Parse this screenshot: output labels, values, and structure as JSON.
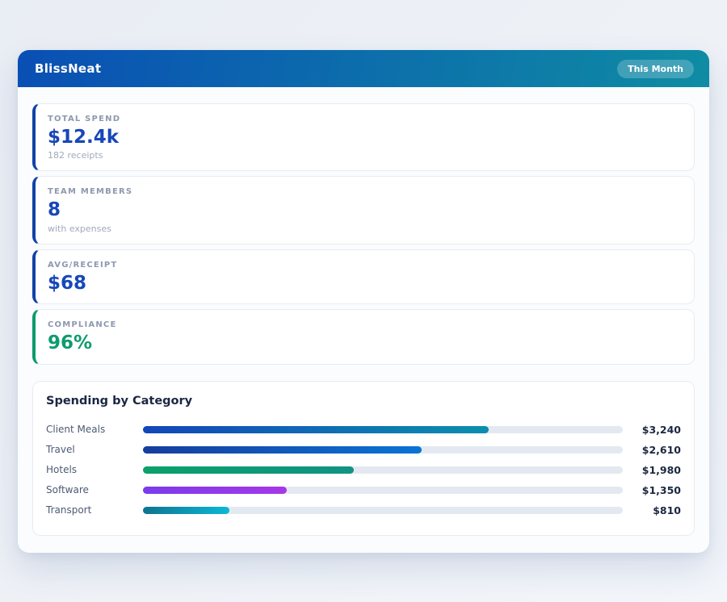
{
  "header": {
    "app_name": "BlissNeat",
    "period_badge": "This Month",
    "gradient_start": "#0a4fb4",
    "gradient_end": "#0f8ca3"
  },
  "stats": [
    {
      "label": "TOTAL SPEND",
      "value": "$12.4k",
      "sub": "182 receipts",
      "accent_color": "#1243a6",
      "value_color": "#1747b8"
    },
    {
      "label": "TEAM MEMBERS",
      "value": "8",
      "sub": "with expenses",
      "accent_color": "#1243a6",
      "value_color": "#1747b8"
    },
    {
      "label": "AVG/RECEIPT",
      "value": "$68",
      "sub": "",
      "accent_color": "#1243a6",
      "value_color": "#1747b8"
    },
    {
      "label": "COMPLIANCE",
      "value": "96%",
      "sub": "",
      "accent_color": "#0d9b6d",
      "value_color": "#0d9b6d"
    }
  ],
  "spending": {
    "title": "Spending by Category",
    "chart_data": {
      "type": "bar",
      "categories": [
        "Client Meals",
        "Travel",
        "Hotels",
        "Software",
        "Transport"
      ],
      "values": [
        3240,
        2610,
        1980,
        1350,
        810
      ],
      "value_labels": [
        "$3,240",
        "$2,610",
        "$1,980",
        "$1,350",
        "$810"
      ],
      "scale_max": 4500,
      "percents": [
        72,
        58,
        44,
        30,
        18
      ],
      "bar_gradients": [
        {
          "from": "#1346b8",
          "to": "#0b8fae"
        },
        {
          "from": "#173d9e",
          "to": "#0b73d4"
        },
        {
          "from": "#0aa06a",
          "to": "#109384"
        },
        {
          "from": "#7b3bec",
          "to": "#a638e8"
        },
        {
          "from": "#0e7490",
          "to": "#0cb8d6"
        }
      ],
      "track_color": "#e4e9f1",
      "title": "Spending by Category",
      "xlabel": "",
      "ylabel": ""
    }
  }
}
